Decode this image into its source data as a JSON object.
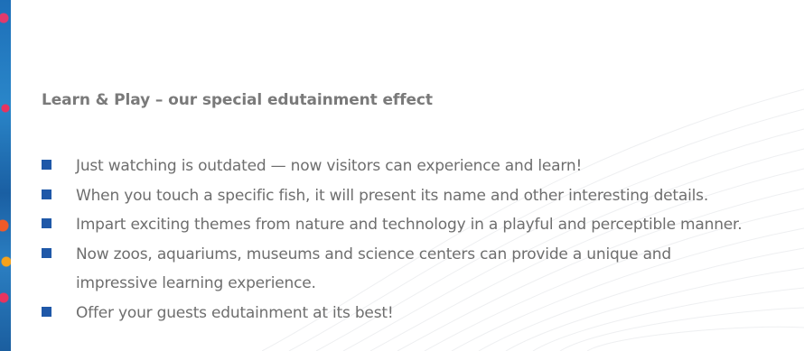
{
  "section": {
    "heading": "Learn & Play – our special edutainment effect",
    "accent_color": "#1f58a8",
    "items": [
      {
        "lines": [
          "Just watching is outdated — now visitors can experience and learn!"
        ]
      },
      {
        "lines": [
          "When you touch a specific fish, it will present its name and other interesting details."
        ]
      },
      {
        "lines": [
          "Impart exciting themes from nature and technology in a playful and perceptible manner."
        ]
      },
      {
        "lines": [
          "Now zoos, aquariums, museums and science centers can provide a unique and",
          "impressive learning experience."
        ]
      },
      {
        "lines": [
          "Offer your guests edutainment at its best!"
        ]
      }
    ]
  },
  "decorations": {
    "left_strip_icon": "coral-reef-image",
    "background_pattern_icon": "wave-pattern"
  }
}
